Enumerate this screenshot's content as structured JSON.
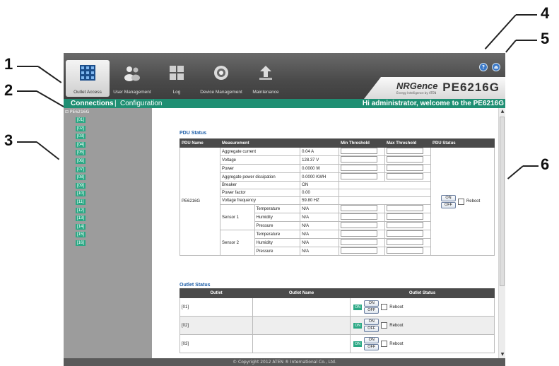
{
  "callouts": [
    "1",
    "2",
    "3",
    "4",
    "5",
    "6"
  ],
  "nav": [
    {
      "label": "Outlet Access",
      "icon": "grid-icon"
    },
    {
      "label": "User Management",
      "icon": "users-icon"
    },
    {
      "label": "Log",
      "icon": "log-icon"
    },
    {
      "label": "Device Management",
      "icon": "device-icon"
    },
    {
      "label": "Maintenance",
      "icon": "maintenance-icon"
    }
  ],
  "brand": {
    "logo": "NRGence",
    "tagline": "Energy Intelligence by ATEN",
    "model": "PE6216G"
  },
  "top_buttons": {
    "help": "?",
    "logout": "⏏"
  },
  "subbar": {
    "connections": "Connections",
    "separator": "|",
    "configuration": "Configuration",
    "welcome": "Hi administrator, welcome to the PE6216G"
  },
  "sidebar": {
    "root": "⊟ PE6216G",
    "ports": [
      "[01]",
      "[02]",
      "[03]",
      "[04]",
      "[05]",
      "[06]",
      "[07]",
      "[08]",
      "[09]",
      "[10]",
      "[11]",
      "[12]",
      "[13]",
      "[14]",
      "[15]",
      "[16]"
    ]
  },
  "pdu_status": {
    "title": "PDU Status",
    "headers": [
      "PDU Name",
      "Measurement",
      "Min Threshold",
      "Max Threshold",
      "PDU Status"
    ],
    "pdu_name": "PE6216G",
    "rows": [
      {
        "label": "Aggregate current",
        "value": "0.04 A"
      },
      {
        "label": "Voltage",
        "value": "128.37 V"
      },
      {
        "label": "Power",
        "value": "0.0000 W"
      },
      {
        "label": "Aggregate power dissipation",
        "value": "0.0000 KWH"
      },
      {
        "label": "Breaker",
        "value": "ON"
      },
      {
        "label": "Power factor",
        "value": "0.00"
      },
      {
        "label": "Voltage frequency",
        "value": "59.80 HZ"
      }
    ],
    "sensors": [
      {
        "name": "Sensor 1",
        "items": [
          {
            "label": "Temperature",
            "value": "N/A"
          },
          {
            "label": "Humidity",
            "value": "N/A"
          },
          {
            "label": "Pressure",
            "value": "N/A"
          }
        ]
      },
      {
        "name": "Sensor 2",
        "items": [
          {
            "label": "Temperature",
            "value": "N/A"
          },
          {
            "label": "Humidity",
            "value": "N/A"
          },
          {
            "label": "Pressure",
            "value": "N/A"
          }
        ]
      }
    ],
    "on_label": "ON",
    "off_label": "OFF",
    "reboot_label": "Reboot"
  },
  "outlet_status": {
    "title": "Outlet Status",
    "headers": [
      "Outlet",
      "Outlet Name",
      "Outlet Status"
    ],
    "rows": [
      {
        "outlet": "[01]",
        "name": "",
        "state": "ON"
      },
      {
        "outlet": "[02]",
        "name": "",
        "state": "ON"
      },
      {
        "outlet": "[03]",
        "name": "",
        "state": "ON"
      }
    ],
    "on_label": "ON",
    "off_label": "OFF",
    "reboot_label": "Reboot"
  },
  "footer": "© Copyright 2012 ATEN ® International Co., Ltd.",
  "colors": {
    "accent": "#1f8f73",
    "port_green": "#2aa884",
    "title_blue": "#1f5fa8",
    "header_dark": "#4a4a4a",
    "sidebar_gray": "#9c9c9c"
  }
}
